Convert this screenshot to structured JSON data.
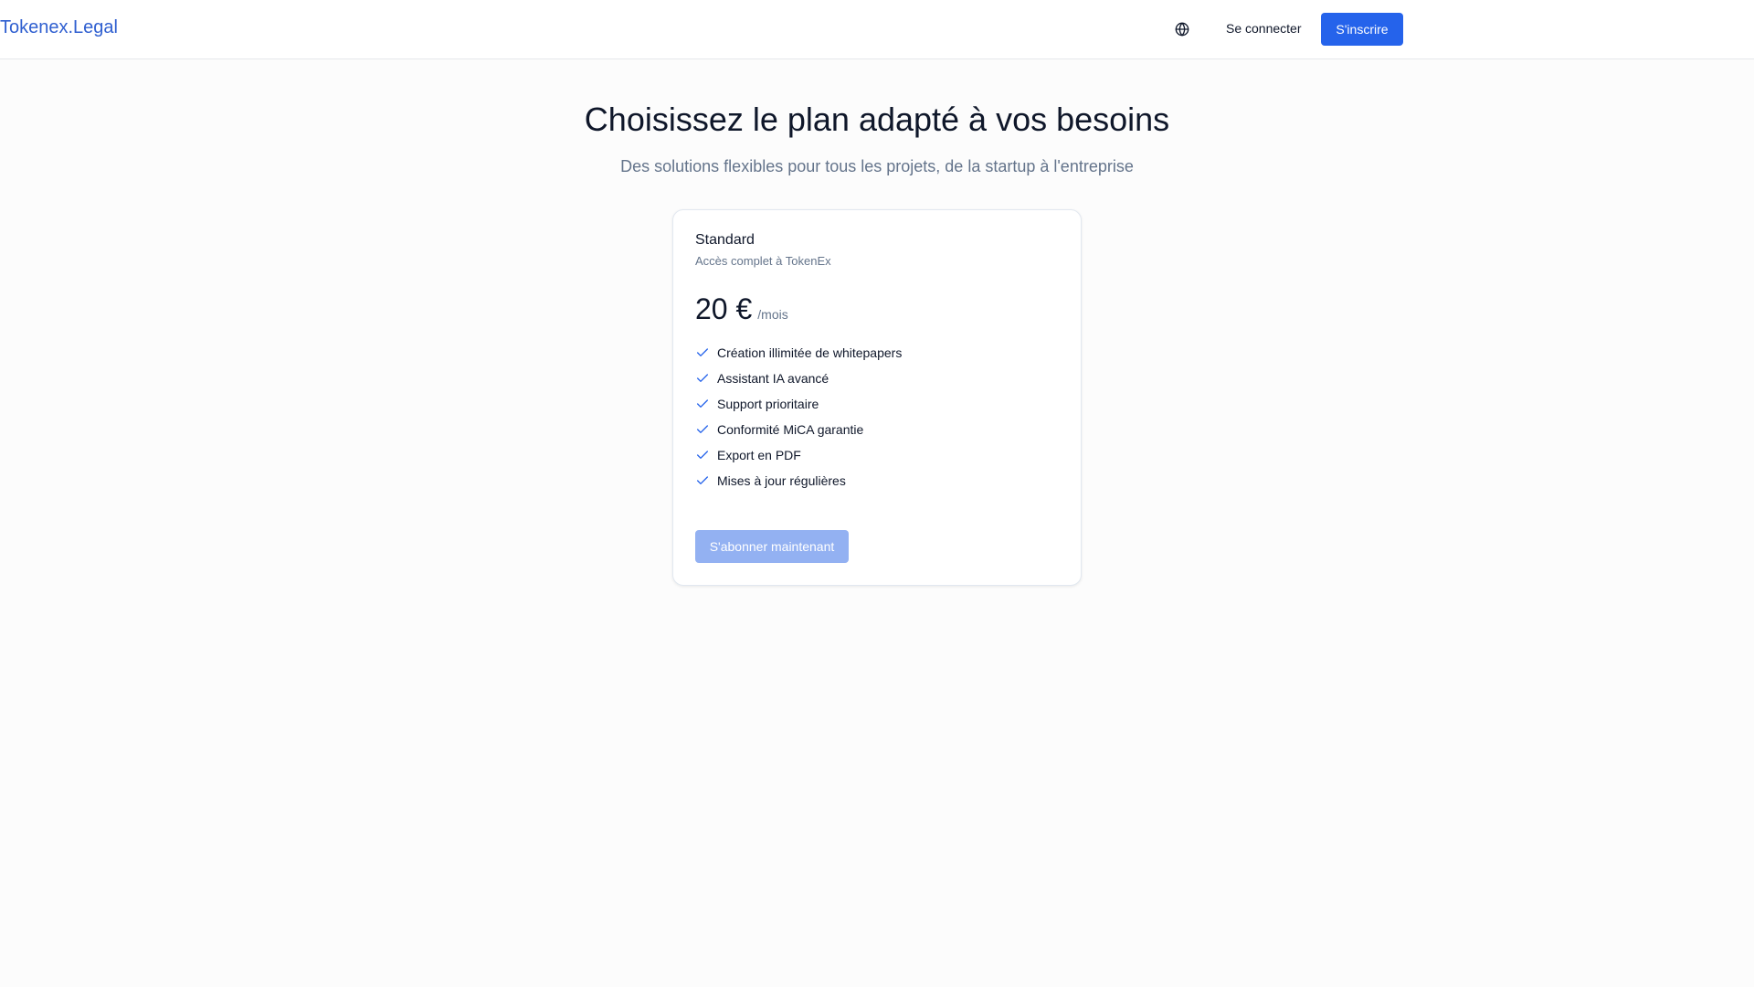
{
  "header": {
    "logo": "Tokenex.Legal",
    "language_icon": "globe-icon",
    "login_label": "Se connecter",
    "signup_label": "S'inscrire"
  },
  "hero": {
    "title": "Choisissez le plan adapté à vos besoins",
    "subtitle": "Des solutions flexibles pour tous les projets, de la startup à l'entreprise"
  },
  "plan": {
    "name": "Standard",
    "description": "Accès complet à TokenEx",
    "price": "20 €",
    "period": "/mois",
    "feature_icon": "check-icon",
    "features": [
      "Création illimitée de whitepapers",
      "Assistant IA avancé",
      "Support prioritaire",
      "Conformité MiCA garantie",
      "Export en PDF",
      "Mises à jour régulières"
    ],
    "cta_label": "S'abonner maintenant",
    "cta_state": "disabled"
  },
  "colors": {
    "brand": "#2563eb",
    "logo": "#2f5fd0",
    "cta_disabled": "#93b1f2",
    "muted_text": "#64748b"
  }
}
